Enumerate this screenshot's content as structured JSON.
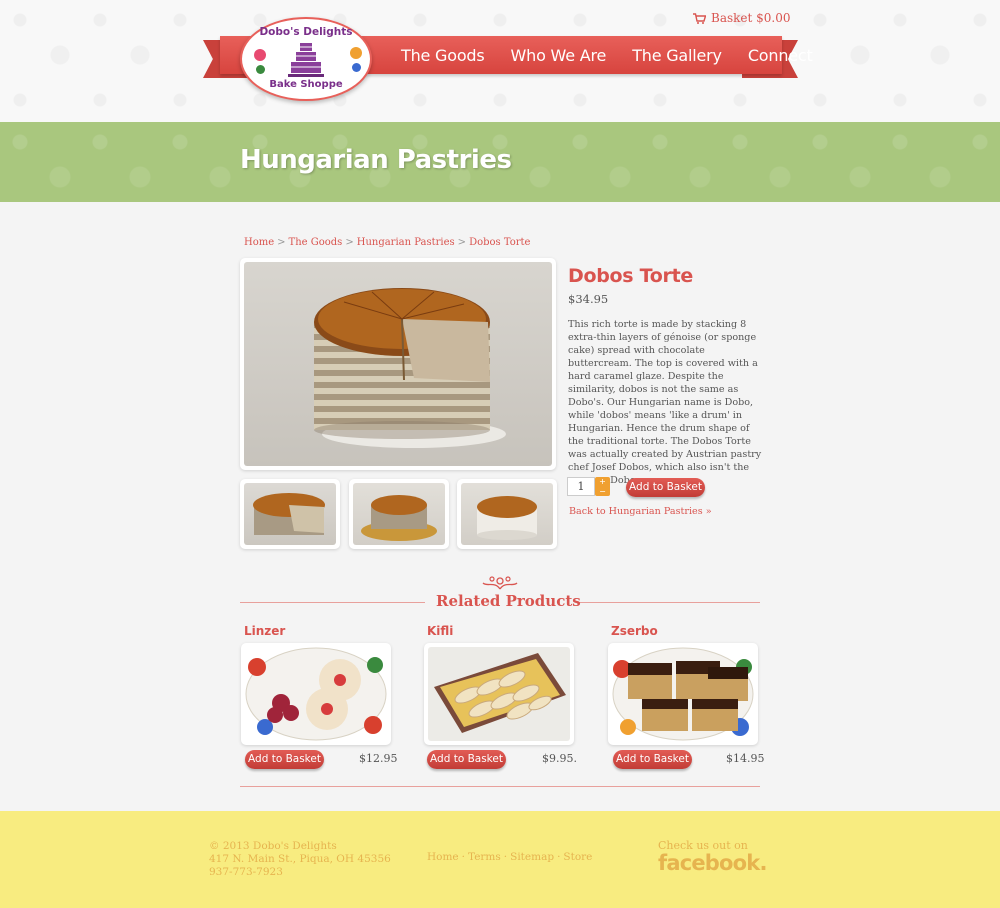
{
  "header": {
    "basket_label": "Basket $0.00",
    "logo_top": "Dobo's Delights",
    "logo_bottom": "Bake Shoppe",
    "nav": [
      "The Goods",
      "Who We Are",
      "The Gallery",
      "Connect"
    ]
  },
  "banner": {
    "title": "Hungarian Pastries"
  },
  "breadcrumb": [
    "Home",
    "The Goods",
    "Hungarian Pastries",
    "Dobos Torte"
  ],
  "product": {
    "title": "Dobos Torte",
    "price": "$34.95",
    "description": "This rich torte is made by stacking 8 extra-thin layers of génoise (or sponge cake) spread with chocolate buttercream. The top is covered with a hard caramel glaze. Despite the similarity, dobos is not the same as Dobo's. Our Hungarian name is Dobo, while 'dobos' means 'like a drum' in Hungarian. Hence the drum shape of the traditional torte. The Dobos Torte was actually created by Austrian pastry chef Josef Dobos, which also isn't the same as Dobo.",
    "quantity": "1",
    "stepper_up": "+",
    "stepper_down": "−",
    "add_label": "Add to Basket",
    "back_label": "Back to Hungarian Pastries »"
  },
  "related": {
    "title": "Related Products",
    "items": [
      {
        "name": "Linzer",
        "price": "$12.95",
        "add_label": "Add to Basket"
      },
      {
        "name": "Kifli",
        "price": "$9.95.",
        "add_label": "Add to Basket"
      },
      {
        "name": "Zserbo",
        "price": "$14.95",
        "add_label": "Add to Basket"
      }
    ]
  },
  "footer": {
    "copyright": "© 2013 Dobo's Delights",
    "address": "417 N. Main St., Piqua, OH 45356",
    "phone": "937-773-7923",
    "links": [
      "Home",
      "Terms",
      "Sitemap",
      "Store"
    ],
    "fb_check": "Check us out on",
    "fb_logo": "facebook."
  },
  "colors": {
    "accent_red": "#d9544f",
    "banner_green": "#a9c77e",
    "footer_yellow": "#f8ec80",
    "footer_text": "#e6b44f",
    "stepper_orange": "#f0a030"
  }
}
